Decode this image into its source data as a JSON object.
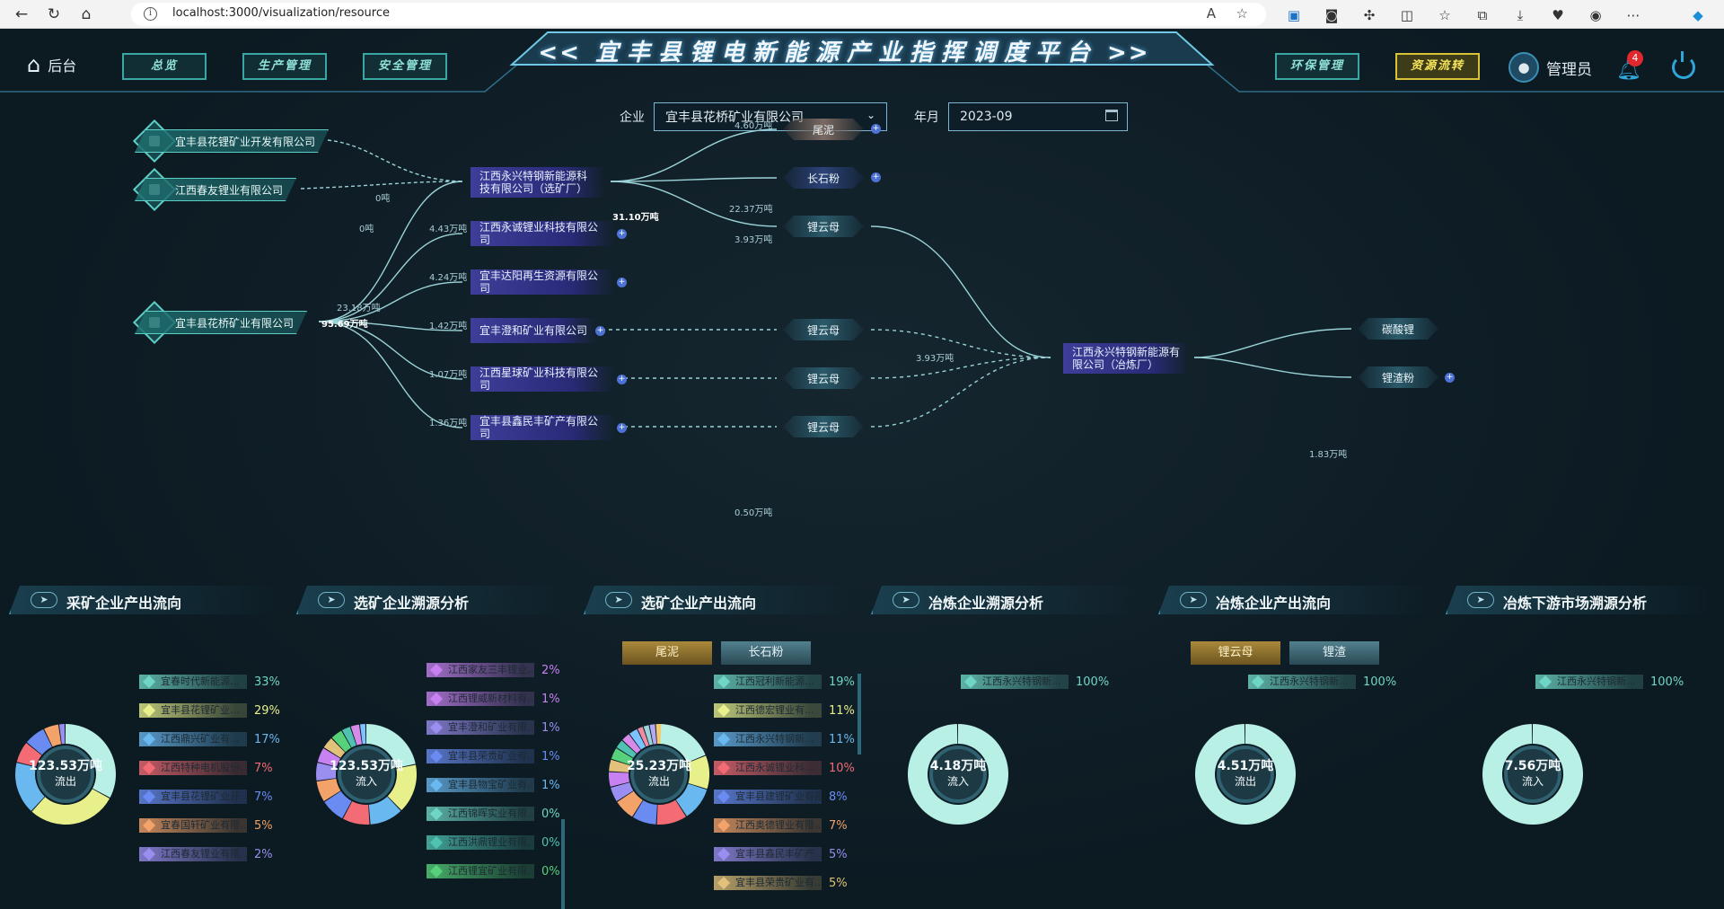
{
  "browser": {
    "url": "localhost:3000/visualization/resource"
  },
  "header": {
    "home_label": "后台",
    "nav": [
      {
        "label": "总览"
      },
      {
        "label": "生产管理"
      },
      {
        "label": "安全管理"
      },
      {
        "label": "环保管理"
      },
      {
        "label": "资源流转",
        "active": true
      }
    ],
    "title": "宜丰县锂电新能源产业指挥调度平台",
    "title_arrows_left": "<<",
    "title_arrows_right": ">>",
    "user_name": "管理员",
    "notification_count": "4"
  },
  "filters": {
    "company_label": "企业",
    "company_value": "宜丰县花桥矿业有限公司",
    "month_label": "年月",
    "month_value": "2023-09"
  },
  "flow": {
    "sources": [
      {
        "name": "宜丰县花锂矿业开发有限公司"
      },
      {
        "name": "江西春友锂业有限公司"
      },
      {
        "name": "宜丰县花桥矿业有限公司"
      }
    ],
    "processors": [
      {
        "name": "江西永兴特钢新能源科技有限公司（选矿厂）"
      },
      {
        "name": "江西永诚锂业科技有限公司"
      },
      {
        "name": "宜丰达阳再生资源有限公司"
      },
      {
        "name": "宜丰澄和矿业有限公司"
      },
      {
        "name": "江西星球矿业科技有限公司"
      },
      {
        "name": "宜丰县鑫民丰矿产有限公司"
      }
    ],
    "products": [
      {
        "name": "尾泥",
        "color": "brown"
      },
      {
        "name": "长石粉",
        "color": "blue"
      },
      {
        "name": "锂云母",
        "color": "green"
      },
      {
        "name": "锂云母",
        "color": "green"
      },
      {
        "name": "锂云母",
        "color": "green"
      },
      {
        "name": "锂云母",
        "color": "green"
      }
    ],
    "smelter": {
      "name": "江西永兴特钢新能源有限公司（冶炼厂）"
    },
    "outputs": [
      {
        "name": "碳酸锂"
      },
      {
        "name": "锂渣粉"
      }
    ],
    "labels": {
      "src1": "0吨",
      "src2": "0吨",
      "src3_main": "95.69万吨",
      "src3_up": "23.18万吨",
      "proc_in": "31.10万吨",
      "p2": "4.43万吨",
      "p3": "4.24万吨",
      "p4": "1.42万吨",
      "p5": "1.07万吨",
      "p6": "1.36万吨",
      "weini": "4.60万吨",
      "changshi": "22.37万吨",
      "liyun": "3.93万吨",
      "to_smelter": "3.93万吨",
      "p6_out": "0.50万吨",
      "lizha": "1.83万吨"
    }
  },
  "panels": [
    {
      "title": "采矿企业产出流向",
      "center_value": "123.53万吨",
      "center_label": "流出",
      "legend": [
        {
          "name": "宜春时代新能源...",
          "pct": "33%",
          "color": "#6fd6c6"
        },
        {
          "name": "宜丰县花锂矿业...",
          "pct": "29%",
          "color": "#e8f08c"
        },
        {
          "name": "江西鼎兴矿业有...",
          "pct": "17%",
          "color": "#6ab8f0"
        },
        {
          "name": "江西特种电机股份...",
          "pct": "7%",
          "color": "#f36b74"
        },
        {
          "name": "宜丰县花锂矿业开...",
          "pct": "7%",
          "color": "#6a8cf2"
        },
        {
          "name": "宜春国轩矿业有限...",
          "pct": "5%",
          "color": "#f3a26a"
        },
        {
          "name": "江西春友锂业有限...",
          "pct": "2%",
          "color": "#9a8ef0"
        }
      ]
    },
    {
      "title": "选矿企业溯源分析",
      "center_value": "123.53万吨",
      "center_label": "流入",
      "legend": [
        {
          "name": "江西家友三丰锂业...",
          "pct": "2%",
          "color": "#c781f0"
        },
        {
          "name": "江西锂威新材料有...",
          "pct": "1%",
          "color": "#c781f0"
        },
        {
          "name": "宜丰澄和矿业有限...",
          "pct": "1%",
          "color": "#9a8ef0"
        },
        {
          "name": "宜丰县荣贵矿业有...",
          "pct": "1%",
          "color": "#6a8cf2"
        },
        {
          "name": "宜丰县物宝矿业有...",
          "pct": "1%",
          "color": "#6ab8f0"
        },
        {
          "name": "江西锦晖实业有限...",
          "pct": "0%",
          "color": "#6fd6c6"
        },
        {
          "name": "江西洪鼎锂业有限...",
          "pct": "0%",
          "color": "#4fc2b2"
        },
        {
          "name": "江西锂宜矿业有限...",
          "pct": "0%",
          "color": "#57d27a"
        }
      ]
    },
    {
      "title": "选矿企业产出流向",
      "tabs": [
        "尾泥",
        "长石粉"
      ],
      "center_value": "25.23万吨",
      "center_label": "流出",
      "legend": [
        {
          "name": "江西冠利新能源...",
          "pct": "19%",
          "color": "#6fd6c6"
        },
        {
          "name": "江西德宏锂业有...",
          "pct": "11%",
          "color": "#e8f08c"
        },
        {
          "name": "江西永兴特钢新...",
          "pct": "11%",
          "color": "#6ab8f0"
        },
        {
          "name": "江西永诚锂业科...",
          "pct": "10%",
          "color": "#f36b74"
        },
        {
          "name": "宜丰县建锂矿业有限...",
          "pct": "8%",
          "color": "#6a8cf2"
        },
        {
          "name": "江西奥德锂业有限...",
          "pct": "7%",
          "color": "#f3a26a"
        },
        {
          "name": "宜丰县鑫民丰矿产...",
          "pct": "5%",
          "color": "#9a8ef0"
        },
        {
          "name": "宜丰县荣贵矿业有...",
          "pct": "5%",
          "color": "#e2c17a"
        }
      ]
    },
    {
      "title": "冶炼企业溯源分析",
      "center_value": "4.18万吨",
      "center_label": "流入",
      "legend": [
        {
          "name": "江西永兴特钢新...",
          "pct": "100%",
          "color": "#6fd6c6"
        }
      ]
    },
    {
      "title": "冶炼企业产出流向",
      "tabs": [
        "锂云母",
        "锂渣"
      ],
      "center_value": "4.51万吨",
      "center_label": "流出",
      "legend": [
        {
          "name": "江西永兴特钢新...",
          "pct": "100%",
          "color": "#6fd6c6"
        }
      ]
    },
    {
      "title": "冶炼下游市场溯源分析",
      "center_value": "7.56万吨",
      "center_label": "流入",
      "legend": [
        {
          "name": "江西永兴特钢新...",
          "pct": "100%",
          "color": "#6fd6c6"
        }
      ]
    }
  ],
  "colors": {
    "accent": "#5ccfc6",
    "active_nav": "#d8c237",
    "node": "#3e3e9a"
  }
}
